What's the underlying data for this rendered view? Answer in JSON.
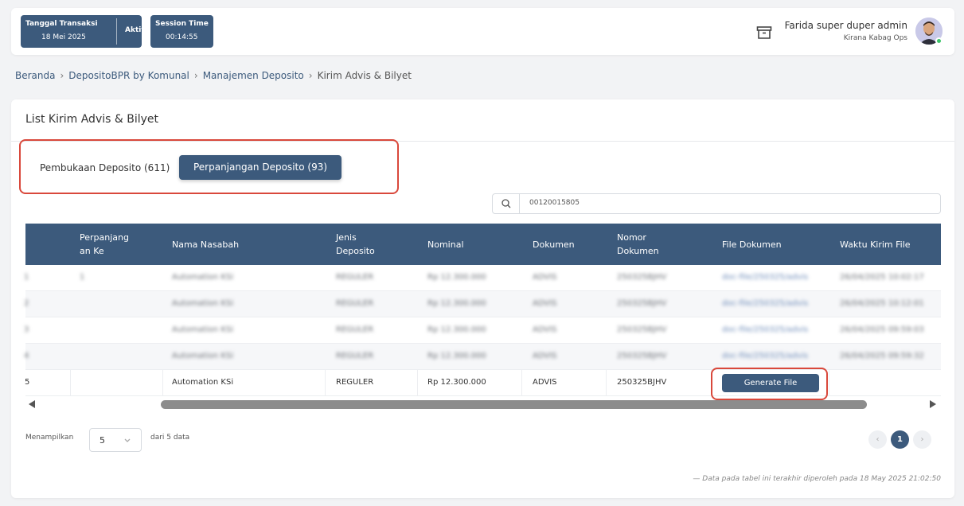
{
  "header": {
    "transaction_title": "Tanggal Transaksi",
    "transaction_date": "18 Mei 2025",
    "transaction_status": "Aktif",
    "session_title": "Session Time",
    "session_time": "00:14:55",
    "user_name": "Farida super duper admin",
    "user_role": "Kirana Kabag Ops"
  },
  "breadcrumb": [
    "Beranda",
    "DepositoBPR by Komunal",
    "Manajemen Deposito",
    "Kirim Advis & Bilyet"
  ],
  "page": {
    "title": "List Kirim Advis & Bilyet",
    "tabs": [
      {
        "label": "Pembukaan Deposito (611)",
        "active": false
      },
      {
        "label": "Perpanjangan Deposito (93)",
        "active": true
      }
    ],
    "search_value": "00120015805"
  },
  "table": {
    "columns": [
      "Perpanjang an Ke",
      "Nama Nasabah",
      "Jenis Deposito",
      "Nominal",
      "Dokumen",
      "Nomor Dokumen",
      "File Dokumen",
      "Waktu Kirim File"
    ],
    "column_lines": [
      [
        "",
        ""
      ],
      [
        "Perpanjang",
        "an Ke"
      ],
      [
        "Nama Nasabah",
        ""
      ],
      [
        "Jenis",
        "Deposito"
      ],
      [
        "Nominal",
        ""
      ],
      [
        "Dokumen",
        ""
      ],
      [
        "Nomor",
        "Dokumen"
      ],
      [
        "File Dokumen",
        ""
      ],
      [
        "Waktu Kirim File",
        ""
      ]
    ],
    "blurred_rows": [
      [
        "1",
        "1",
        "Automation KSi",
        "REGULER",
        "Rp 12.300.000",
        "ADVIS",
        "250325BJHV",
        "doc-file/250325/advis",
        "26/04/2025 10:02:17"
      ],
      [
        "2",
        "",
        "Automation KSi",
        "REGULER",
        "Rp 12.300.000",
        "ADVIS",
        "250325BJHV",
        "doc-file/250325/advis",
        "26/04/2025 10:12:01"
      ],
      [
        "3",
        "",
        "Automation KSi",
        "REGULER",
        "Rp 12.300.000",
        "ADVIS",
        "250325BJHV",
        "doc-file/250325/advis",
        "26/04/2025 09:59:03"
      ],
      [
        "4",
        "",
        "Automation KSi",
        "REGULER",
        "Rp 12.300.000",
        "ADVIS",
        "250325BJHV",
        "doc-file/250325/advis",
        "26/04/2025 09:59:32"
      ]
    ],
    "last_row": {
      "no": "5",
      "perpanjangan_ke": "",
      "nama_nasabah": "Automation KSi",
      "jenis_deposito": "REGULER",
      "nominal": "Rp 12.300.000",
      "dokumen": "ADVIS",
      "nomor_dokumen": "250325BJHV",
      "action_label": "Generate File"
    }
  },
  "footer": {
    "show_label": "Menampilkan",
    "page_size": "5",
    "of_label": "dari 5 data",
    "current_page": "1",
    "note": "— Data pada tabel ini terakhir diperoleh pada 18 May 2025 21:02:50"
  },
  "colors": {
    "primary": "#3c5a7c",
    "highlight": "#d9483b",
    "online": "#3cc46a"
  }
}
